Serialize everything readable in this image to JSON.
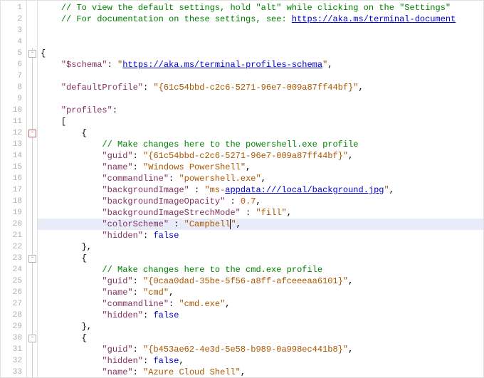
{
  "comments": {
    "header1": "// To view the default settings, hold \"alt\" while clicking on the \"Settings\" ",
    "header2_a": "// For documentation on these settings, see: ",
    "header2_link": "https://aka.ms/terminal-document",
    "profile1": "// Make changes here to the powershell.exe profile",
    "profile2": "// Make changes here to the cmd.exe profile"
  },
  "keys": {
    "schema": "\"$schema\"",
    "defaultProfile": "\"defaultProfile\"",
    "profiles": "\"profiles\"",
    "guid": "\"guid\"",
    "name": "\"name\"",
    "commandline": "\"commandline\"",
    "backgroundImage": "\"backgroundImage\"",
    "backgroundImageOpacity": "\"backgroundImageOpacity\"",
    "backgroundImageStrechMode": "\"backgroundImageStrechMode\"",
    "colorScheme": "\"colorScheme\"",
    "hidden": "\"hidden\""
  },
  "vals": {
    "schema_link": "https://aka.ms/terminal-profiles-schema",
    "defaultProfile": "\"{61c54bbd-c2c6-5271-96e7-009a87ff44bf}\"",
    "p1_guid": "\"{61c54bbd-c2c6-5271-96e7-009a87ff44bf}\"",
    "p1_name": "\"Windows PowerShell\"",
    "p1_cmd": "\"powershell.exe\"",
    "p1_bg_a": "\"ms-",
    "p1_bg_link": "appdata:///local/background.jpg",
    "p1_bg_b": "\"",
    "p1_opacity": "0.7",
    "p1_stretch": "\"fill\"",
    "p1_scheme_a": "\"Campbell",
    "p1_scheme_b": "\"",
    "p2_guid": "\"{0caa0dad-35be-5f56-a8ff-afceeeaa6101}\"",
    "p2_name": "\"cmd\"",
    "p2_cmd": "\"cmd.exe\"",
    "p3_guid": "\"{b453ae62-4e3d-5e58-b989-0a998ec441b8}\"",
    "p3_name": "\"Azure Cloud Shell\"",
    "false": "false"
  },
  "punc": {
    "colon": ": ",
    "colonSpace": " : ",
    "comma": ",",
    "brace_o": "{",
    "brace_c": "}",
    "bracket_o": "[",
    "brace_c_comma": "},",
    "q": "\""
  },
  "lines": [
    "1",
    "2",
    "3",
    "4",
    "5",
    "6",
    "7",
    "8",
    "9",
    "10",
    "11",
    "12",
    "13",
    "14",
    "15",
    "16",
    "17",
    "18",
    "19",
    "20",
    "21",
    "22",
    "23",
    "24",
    "25",
    "26",
    "27",
    "28",
    "29",
    "30",
    "31",
    "32",
    "33"
  ],
  "chart_data": null
}
